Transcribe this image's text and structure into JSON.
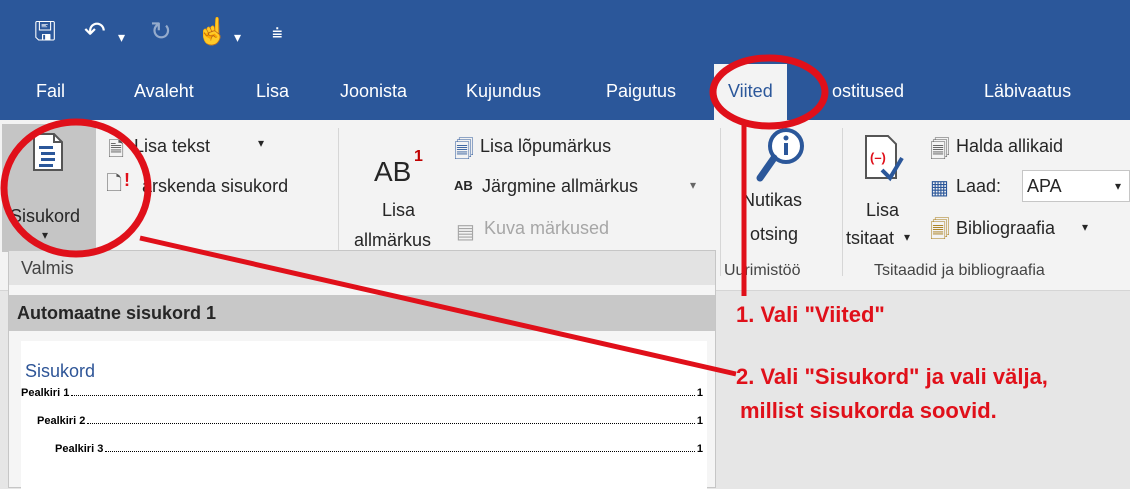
{
  "tabs": [
    {
      "label": "Fail"
    },
    {
      "label": "Avaleht"
    },
    {
      "label": "Lisa"
    },
    {
      "label": "Joonista"
    },
    {
      "label": "Kujundus"
    },
    {
      "label": "Paigutus"
    },
    {
      "label": "Viited"
    },
    {
      "label": "ostitused"
    },
    {
      "label": "Läbivaatus"
    }
  ],
  "ribbon": {
    "toc_button": "Sisukord",
    "add_text": "Lisa tekst",
    "update_toc": "ärskenda sisukord",
    "ab_label": "AB",
    "ab_sup": "1",
    "insert_footnote_1": "Lisa",
    "insert_footnote_2": "allmärkus",
    "insert_endnote": "Lisa lõpumärkus",
    "next_footnote": "Järgmine allmärkus",
    "show_notes": "Kuva märkused",
    "smart_1": "Nutikas",
    "smart_2": "otsing",
    "research_group": "Uurimistöö",
    "insert_citation_1": "Lisa",
    "insert_citation_2": "tsitaat",
    "manage_sources": "Halda allikaid",
    "style_label": "Laad:",
    "style_value": "APA",
    "bibliography": "Bibliograafia",
    "citations_group": "Tsitaadid ja bibliograafia"
  },
  "dropdown": {
    "section": "Valmis",
    "item_title": "Automaatne sisukord 1",
    "preview_title": "Sisukord",
    "lines": [
      {
        "text": "Pealkiri 1",
        "page": "1"
      },
      {
        "text": "Pealkiri 2",
        "page": "1"
      },
      {
        "text": "Pealkiri 3",
        "page": "1"
      }
    ]
  },
  "annotations": {
    "step1": "1. Vali \"Viited\"",
    "step2_line1": "2. Vali \"Sisukord\" ja vali välja,",
    "step2_line2": "millist sisukorda soovid."
  },
  "colors": {
    "title_blue": "#2b579a",
    "annotation_red": "#e0101a"
  }
}
